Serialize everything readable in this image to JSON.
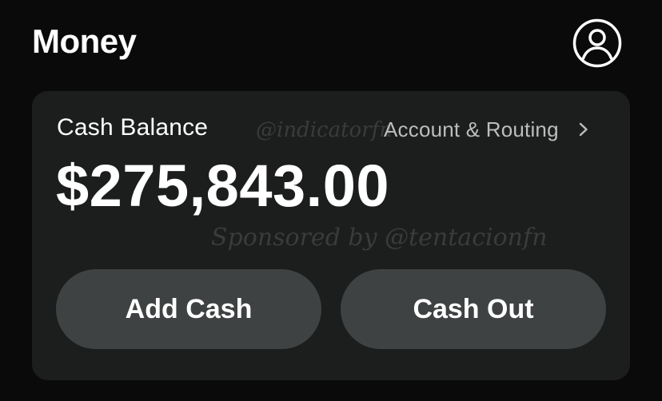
{
  "header": {
    "title": "Money",
    "profile_icon": "person-circle-icon"
  },
  "balance_card": {
    "label": "Cash Balance",
    "amount": "$275,843.00",
    "account_link_label": "Account & Routing",
    "account_link_icon": "chevron-right-icon",
    "watermarks": [
      "@indicatorfn",
      "Sponsored by @tentacionfn"
    ]
  },
  "actions": {
    "add_cash_label": "Add Cash",
    "cash_out_label": "Cash Out"
  },
  "colors": {
    "background": "#0b0a0a",
    "card": "#1c1d1d",
    "button": "#3f4242",
    "text_primary": "#ffffff",
    "text_secondary": "#bdbdbd"
  }
}
